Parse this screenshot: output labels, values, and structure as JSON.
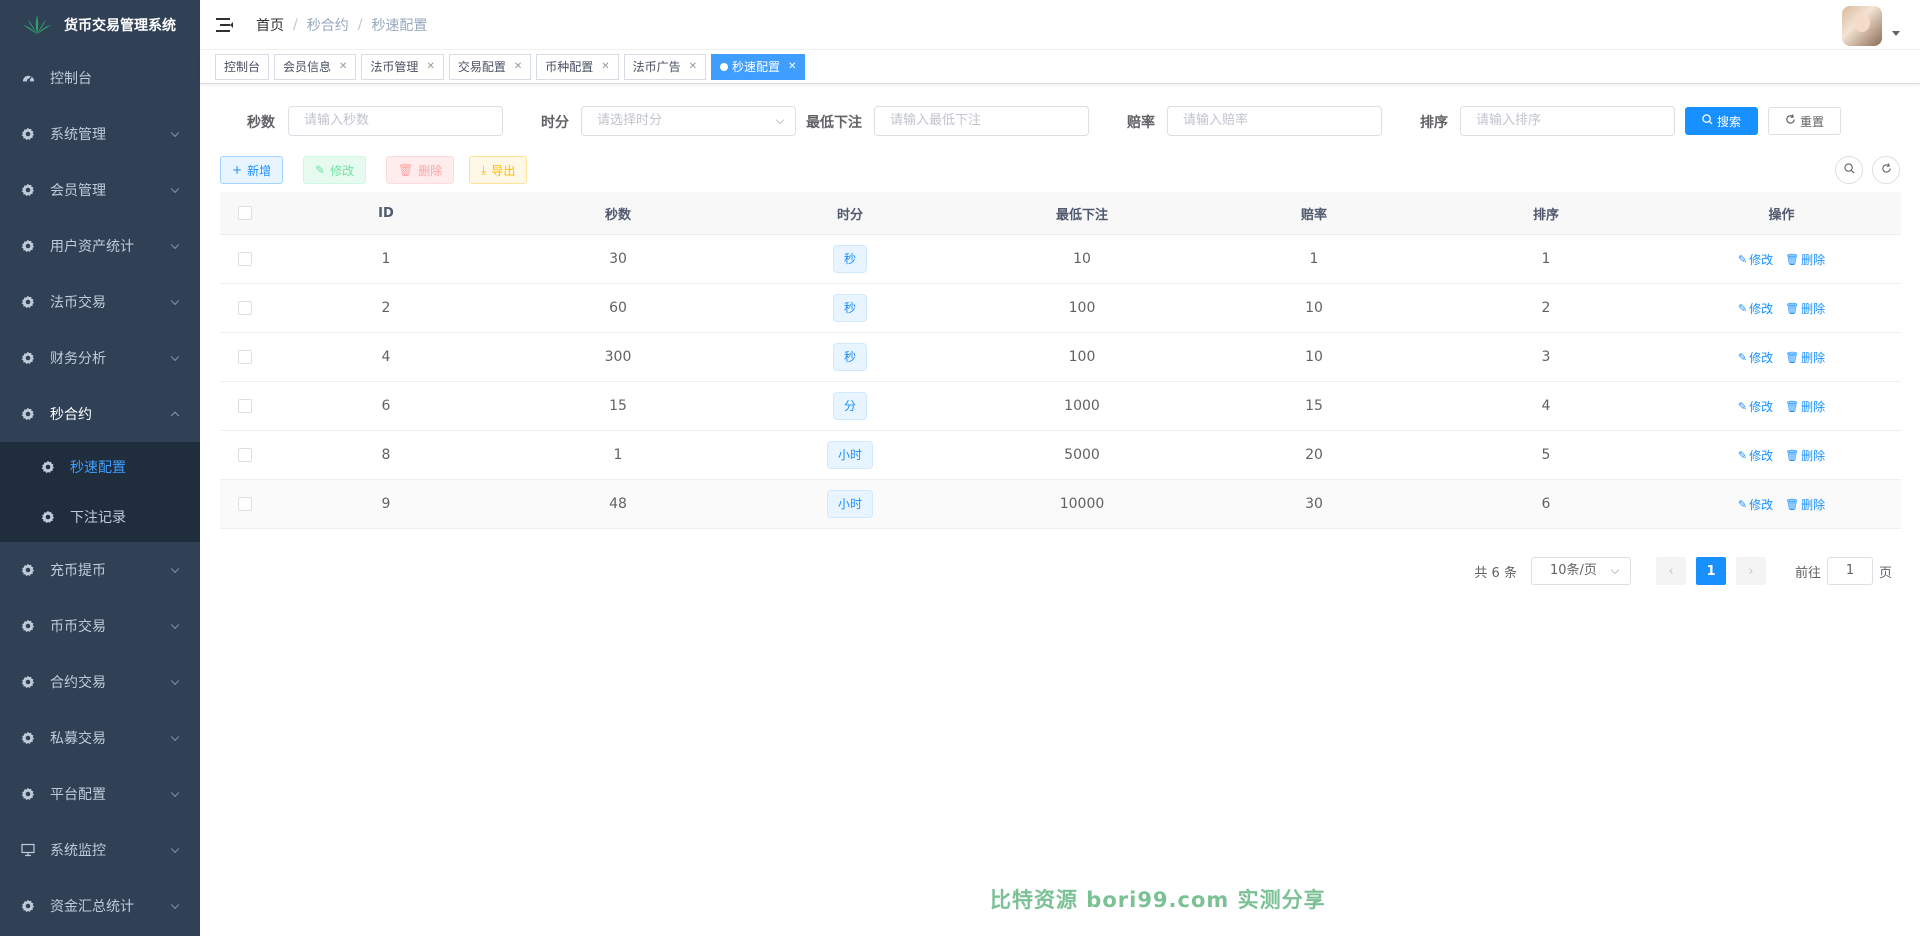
{
  "app": {
    "title": "货币交易管理系统"
  },
  "sidebar": {
    "items": [
      {
        "label": "控制台",
        "icon": "dashboard-icon",
        "has_arrow": false
      },
      {
        "label": "系统管理",
        "icon": "gear-icon",
        "has_arrow": true
      },
      {
        "label": "会员管理",
        "icon": "gear-icon",
        "has_arrow": true
      },
      {
        "label": "用户资产统计",
        "icon": "gear-icon",
        "has_arrow": true
      },
      {
        "label": "法币交易",
        "icon": "gear-icon",
        "has_arrow": true
      },
      {
        "label": "财务分析",
        "icon": "gear-icon",
        "has_arrow": true
      },
      {
        "label": "秒合约",
        "icon": "gear-icon",
        "has_arrow": true,
        "open": true
      },
      {
        "label": "充币提币",
        "icon": "gear-icon",
        "has_arrow": true
      },
      {
        "label": "币币交易",
        "icon": "gear-icon",
        "has_arrow": true
      },
      {
        "label": "合约交易",
        "icon": "gear-icon",
        "has_arrow": true
      },
      {
        "label": "私募交易",
        "icon": "gear-icon",
        "has_arrow": true
      },
      {
        "label": "平台配置",
        "icon": "gear-icon",
        "has_arrow": true
      },
      {
        "label": "系统监控",
        "icon": "monitor-icon",
        "has_arrow": true
      },
      {
        "label": "资金汇总统计",
        "icon": "gear-icon",
        "has_arrow": true
      }
    ],
    "submenu": [
      {
        "label": "秒速配置",
        "active": true
      },
      {
        "label": "下注记录",
        "active": false
      }
    ]
  },
  "breadcrumb": [
    "首页",
    "秒合约",
    "秒速配置"
  ],
  "tags": [
    {
      "label": "控制台",
      "closable": false,
      "active": false
    },
    {
      "label": "会员信息",
      "closable": true,
      "active": false
    },
    {
      "label": "法币管理",
      "closable": true,
      "active": false
    },
    {
      "label": "交易配置",
      "closable": true,
      "active": false
    },
    {
      "label": "币种配置",
      "closable": true,
      "active": false
    },
    {
      "label": "法币广告",
      "closable": true,
      "active": false
    },
    {
      "label": "秒速配置",
      "closable": true,
      "active": true
    }
  ],
  "search": {
    "seconds_label": "秒数",
    "seconds_placeholder": "请输入秒数",
    "unit_label": "时分",
    "unit_placeholder": "请选择时分",
    "min_bet_label": "最低下注",
    "min_bet_placeholder": "请输入最低下注",
    "odds_label": "赔率",
    "odds_placeholder": "请输入赔率",
    "sort_label": "排序",
    "sort_placeholder": "请输入排序",
    "search_btn": "搜索",
    "reset_btn": "重置"
  },
  "toolbar": {
    "add": "新增",
    "edit": "修改",
    "delete": "删除",
    "export": "导出"
  },
  "table": {
    "headers": [
      "ID",
      "秒数",
      "时分",
      "最低下注",
      "赔率",
      "排序",
      "操作"
    ],
    "rows": [
      {
        "id": "1",
        "seconds": "30",
        "unit": "秒",
        "min_bet": "10",
        "odds": "1",
        "sort": "1"
      },
      {
        "id": "2",
        "seconds": "60",
        "unit": "秒",
        "min_bet": "100",
        "odds": "10",
        "sort": "2"
      },
      {
        "id": "4",
        "seconds": "300",
        "unit": "秒",
        "min_bet": "100",
        "odds": "10",
        "sort": "3"
      },
      {
        "id": "6",
        "seconds": "15",
        "unit": "分",
        "min_bet": "1000",
        "odds": "15",
        "sort": "4"
      },
      {
        "id": "8",
        "seconds": "1",
        "unit": "小时",
        "min_bet": "5000",
        "odds": "20",
        "sort": "5"
      },
      {
        "id": "9",
        "seconds": "48",
        "unit": "小时",
        "min_bet": "10000",
        "odds": "30",
        "sort": "6"
      }
    ],
    "op_edit": "修改",
    "op_delete": "删除"
  },
  "pagination": {
    "total": "共 6 条",
    "page_size": "10条/页",
    "current": "1",
    "goto_prefix": "前往",
    "goto_value": "1",
    "goto_suffix": "页"
  },
  "watermark": "比特资源 bori99.com 实测分享",
  "colors": {
    "sidebar_bg": "#304156",
    "primary": "#1890ff",
    "active_sub": "#409eff"
  }
}
